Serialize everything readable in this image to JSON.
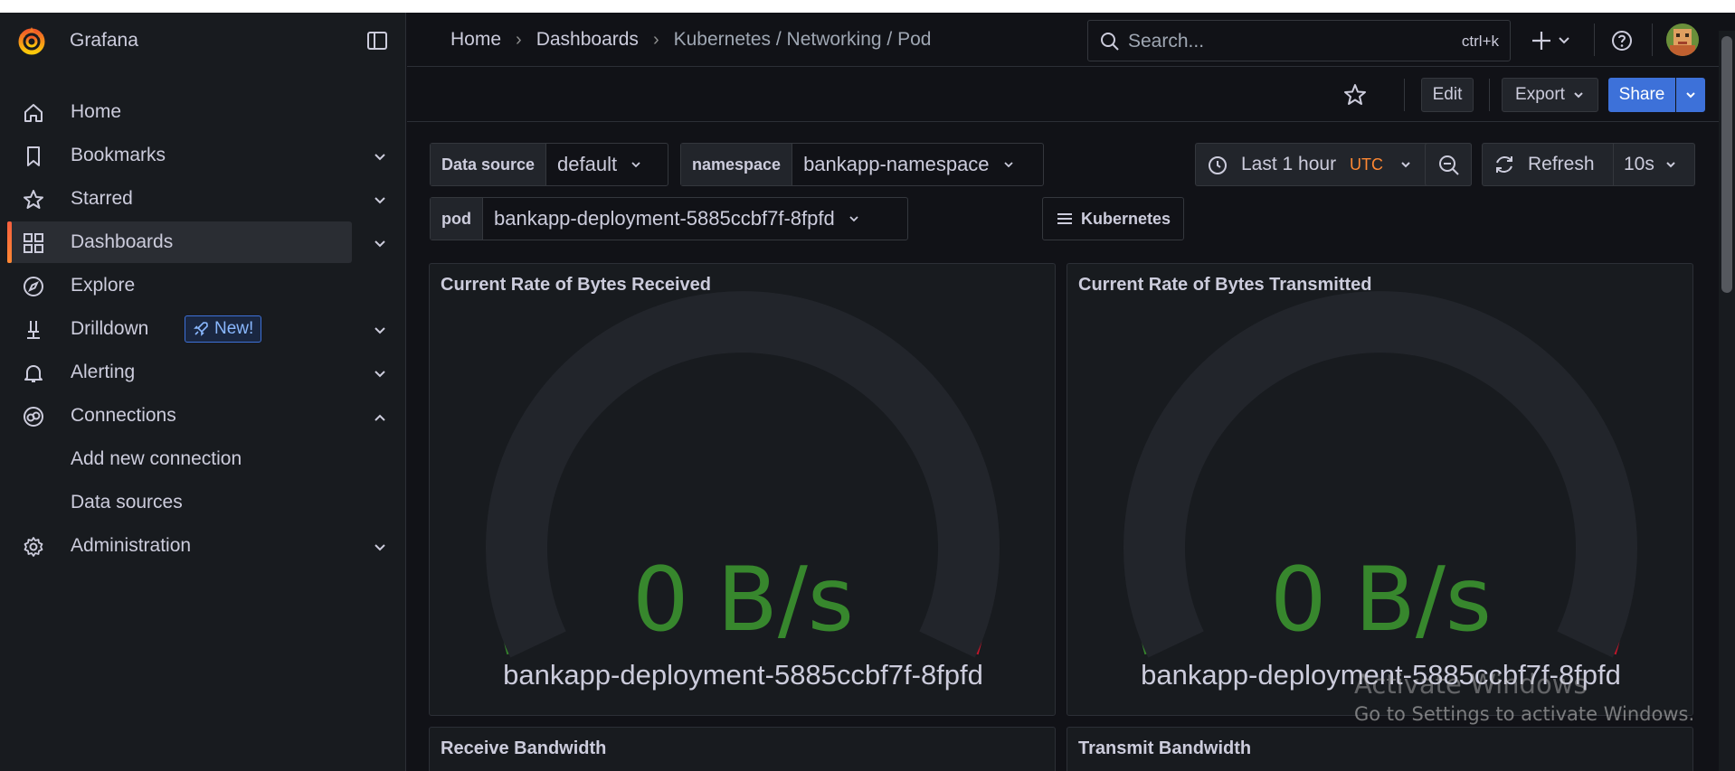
{
  "app": {
    "name": "Grafana"
  },
  "sidebar": {
    "items": [
      {
        "label": "Home"
      },
      {
        "label": "Bookmarks"
      },
      {
        "label": "Starred"
      },
      {
        "label": "Dashboards"
      },
      {
        "label": "Explore"
      },
      {
        "label": "Drilldown",
        "badge": "New!"
      },
      {
        "label": "Alerting"
      },
      {
        "label": "Connections"
      },
      {
        "label": "Add new connection"
      },
      {
        "label": "Data sources"
      },
      {
        "label": "Administration"
      }
    ]
  },
  "breadcrumb": {
    "home": "Home",
    "dashboards": "Dashboards",
    "current": "Kubernetes / Networking / Pod"
  },
  "search": {
    "placeholder": "Search...",
    "shortcut": "ctrl+k"
  },
  "toolbar": {
    "edit": "Edit",
    "export": "Export",
    "share": "Share"
  },
  "variables": {
    "datasource": {
      "label": "Data source",
      "value": "default"
    },
    "namespace": {
      "label": "namespace",
      "value": "bankapp-namespace"
    },
    "pod": {
      "label": "pod",
      "value": "bankapp-deployment-5885ccbf7f-8fpfd"
    }
  },
  "time": {
    "range": "Last 1 hour",
    "tz": "UTC",
    "refresh": "Refresh",
    "interval": "10s"
  },
  "links": {
    "kubernetes": "Kubernetes"
  },
  "panels": [
    {
      "title": "Current Rate of Bytes Received",
      "value": "0 B/s",
      "series": "bankapp-deployment-5885ccbf7f-8fpfd"
    },
    {
      "title": "Current Rate of Bytes Transmitted",
      "value": "0 B/s",
      "series": "bankapp-deployment-5885ccbf7f-8fpfd"
    },
    {
      "title": "Receive Bandwidth"
    },
    {
      "title": "Transmit Bandwidth"
    }
  ],
  "watermark": {
    "line1": "Activate Windows",
    "line2": "Go to Settings to activate Windows."
  },
  "colors": {
    "accent": "#3d71d9",
    "gauge_green": "#37872d",
    "gauge_yellow": "#e0b400",
    "gauge_red": "#c4162a",
    "value_green": "#37872d"
  }
}
